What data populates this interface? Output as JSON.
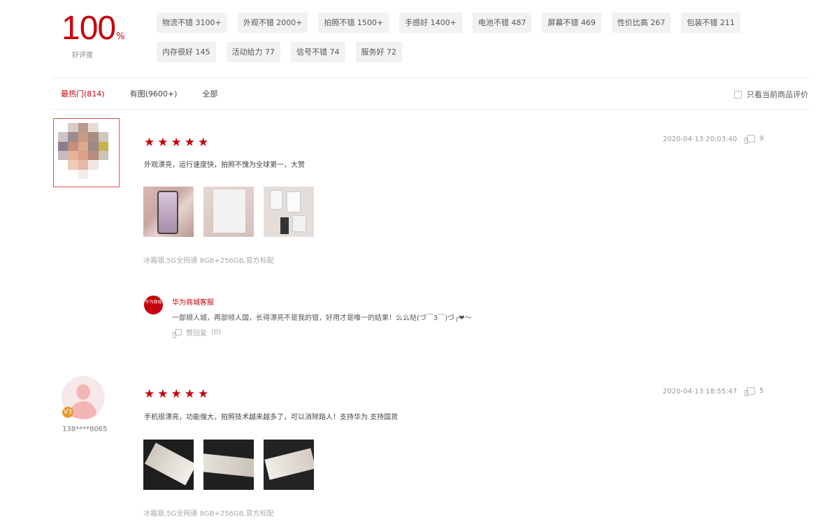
{
  "summary": {
    "score": "100",
    "percent_sign": "%",
    "score_label": "好评度",
    "tags": [
      "物流不错 3100+",
      "外观不错 2000+",
      "拍照不错 1500+",
      "手感好 1400+",
      "电池不错 487",
      "屏幕不错 469",
      "性价比高 267",
      "包装不错 211",
      "内存很好 145",
      "活动给力 77",
      "信号不错 74",
      "服务好 72"
    ]
  },
  "tabs": [
    "最热门(814)",
    "有图(9600+)",
    "全部"
  ],
  "filter": {
    "only_current_label": "只看当前商品评价"
  },
  "reviews": [
    {
      "rating": 5,
      "date": "2020-04-13 20:03:40",
      "likes": "9",
      "text": "外观漂亮，运行速度快，拍照不愧为全球第一，大赞",
      "spec": "冰霜银,5G全网通 8GB+256GB,官方标配",
      "reply": {
        "logo_text": "华为商城",
        "name": "华为商城客服",
        "text": "一部顺人城，再部倾人国，长得漂亮不是我的错，好用才是唯一的结果！么么哒(づ￣3￣)づ╭❤～",
        "like_label": "赞回复",
        "like_count": "(0)"
      }
    },
    {
      "rating": 5,
      "date": "2020-04-13 18:55:47",
      "likes": "5",
      "user": "138****8065",
      "level": "V3",
      "text": "手机很漂亮，功能强大，拍照技术越来越多了，可以消除路人！支持华为 支持国货",
      "spec": "冰霜银,5G全网通 8GB+256GB,官方标配"
    }
  ]
}
